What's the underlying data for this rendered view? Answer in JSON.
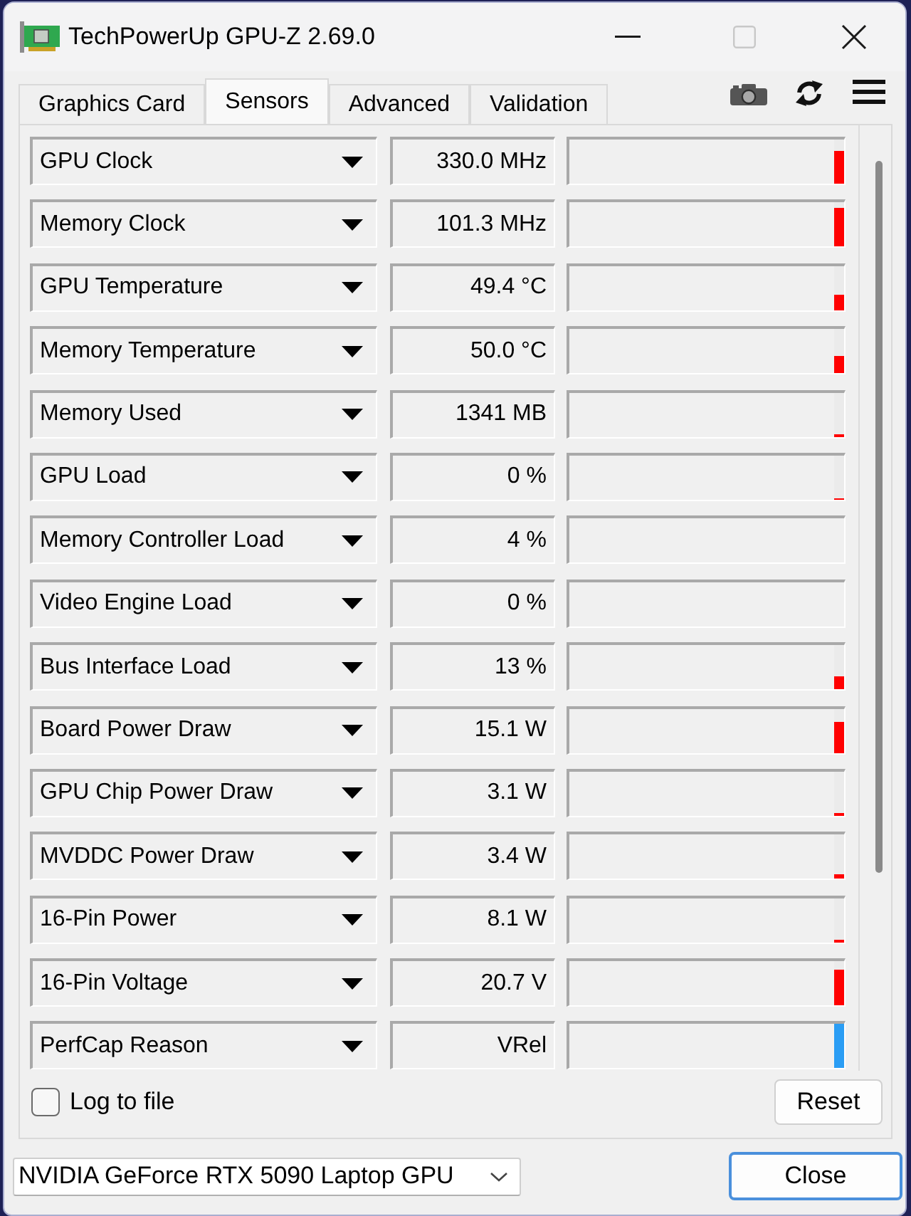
{
  "window": {
    "title": "TechPowerUp GPU-Z 2.69.0",
    "maximize_disabled": true
  },
  "tabs": [
    {
      "label": "Graphics Card",
      "selected": false
    },
    {
      "label": "Sensors",
      "selected": true
    },
    {
      "label": "Advanced",
      "selected": false
    },
    {
      "label": "Validation",
      "selected": false
    }
  ],
  "sensors": [
    {
      "kind": "meter",
      "name": "GPU Clock",
      "value": "330.0 MHz",
      "level": 0.75,
      "color": "#ff0000"
    },
    {
      "kind": "meter",
      "name": "Memory Clock",
      "value": "101.3 MHz",
      "level": 0.88,
      "color": "#ff0000"
    },
    {
      "kind": "meter",
      "name": "GPU Temperature",
      "value": "49.4 °C",
      "level": 0.34,
      "color": "#ff0000"
    },
    {
      "kind": "meter",
      "name": "Memory Temperature",
      "value": "50.0 °C",
      "level": 0.38,
      "color": "#ff0000"
    },
    {
      "kind": "meter",
      "name": "Memory Used",
      "value": "1341 MB",
      "level": 0.06,
      "color": "#ff0000"
    },
    {
      "kind": "meter",
      "name": "GPU Load",
      "value": "0 %",
      "level": 0.03,
      "color": "#ff0000"
    },
    {
      "kind": "meter",
      "name": "Memory Controller Load",
      "value": "4 %"
    },
    {
      "kind": "meter",
      "name": "Video Engine Load",
      "value": "0 %"
    },
    {
      "kind": "meter",
      "name": "Bus Interface Load",
      "value": "13 %",
      "level": 0.3,
      "color": "#ff0000"
    },
    {
      "kind": "meter",
      "name": "Board Power Draw",
      "value": "15.1 W",
      "level": 0.69,
      "color": "#ff0000"
    },
    {
      "kind": "meter",
      "name": "GPU Chip Power Draw",
      "value": "3.1 W",
      "level": 0.05,
      "color": "#ff0000"
    },
    {
      "kind": "meter",
      "name": "MVDDC Power Draw",
      "value": "3.4 W",
      "level": 0.12,
      "color": "#ff0000"
    },
    {
      "kind": "meter",
      "name": "16-Pin Power",
      "value": "8.1 W",
      "level": 0.04,
      "color": "#ff0000"
    },
    {
      "kind": "meter",
      "name": "16-Pin Voltage",
      "value": "20.7 V",
      "level": 0.8,
      "color": "#ff0000"
    },
    {
      "kind": "status",
      "name": "PerfCap Reason",
      "value": "VRel",
      "color": "#2a9df4"
    }
  ],
  "log_to_file": {
    "label": "Log to file",
    "checked": false
  },
  "reset_button": {
    "label": "Reset"
  },
  "gpu_select": {
    "value": "NVIDIA GeForce RTX 5090 Laptop GPU"
  },
  "close_button": {
    "label": "Close"
  }
}
